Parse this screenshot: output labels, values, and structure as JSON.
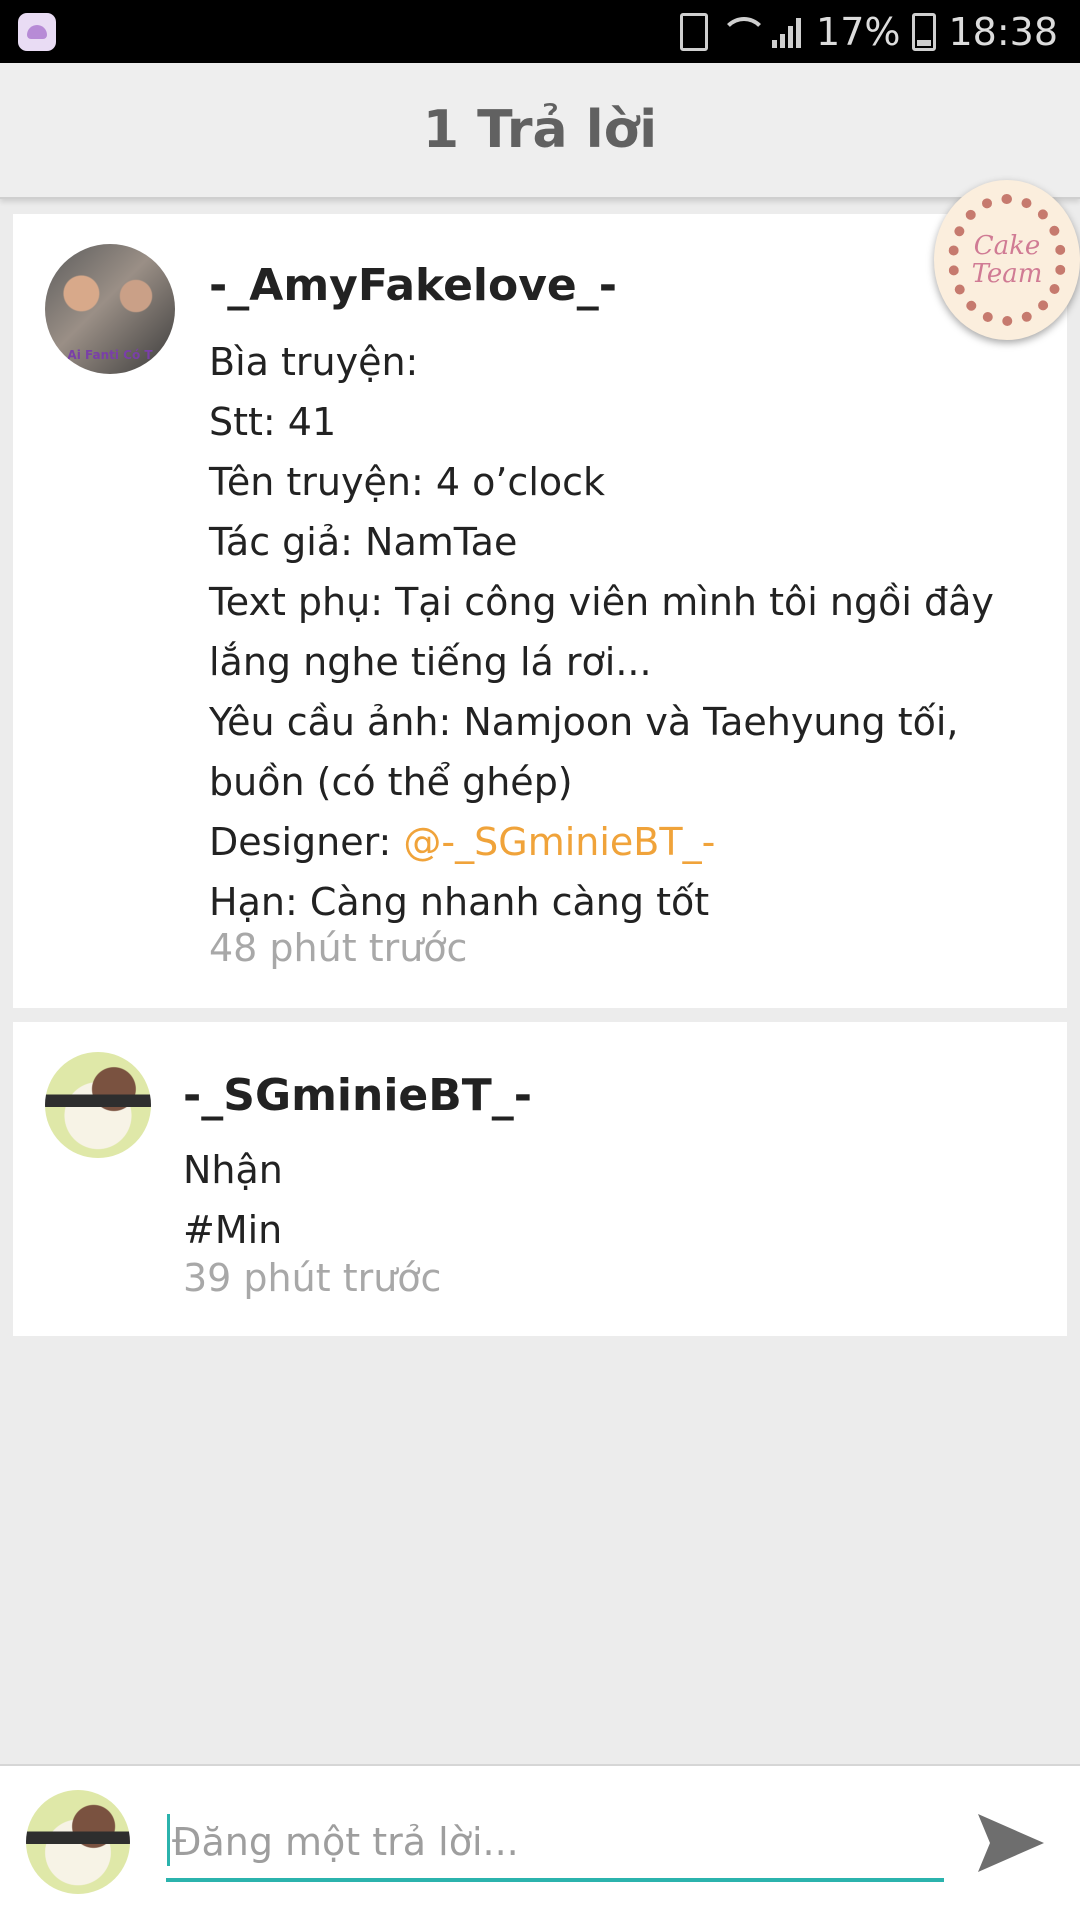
{
  "status_bar": {
    "battery_percent": "17%",
    "time": "18:38",
    "icons": [
      "app-icon",
      "battery-saver-icon",
      "wifi-icon",
      "signal-icon",
      "battery-icon"
    ]
  },
  "header": {
    "title": "1 Trả lời"
  },
  "badge": {
    "text": "Cake\nTeam"
  },
  "posts": [
    {
      "username": "-_AmyFakelove_-",
      "avatar_caption": "Ai Fanti Có T",
      "lines": [
        "Bìa truyện:",
        "Stt: 41",
        "Tên truyện: 4 o’clock",
        "Tác giả: NamTae",
        "Text phụ: Tại công viên mình tôi ngồi đây lắng nghe tiếng lá rơi...",
        "Yêu cầu ảnh: Namjoon và Taehyung tối, buồn (có thể ghép)"
      ],
      "designer_label": "Designer: ",
      "designer_mention": "@-_SGminieBT_-",
      "deadline": "Hạn: Càng nhanh càng tốt",
      "timestamp": "48 phút trước"
    },
    {
      "username": "-_SGminieBT_-",
      "lines": [
        "Nhận",
        "#Min"
      ],
      "timestamp": "39 phút trước"
    }
  ],
  "reply_bar": {
    "placeholder": "Đăng một trả lời...",
    "value": ""
  },
  "colors": {
    "accent": "#2bb3ad",
    "mention": "#f0a33a",
    "header_text": "#616161",
    "timestamp": "#a8a8a8"
  }
}
